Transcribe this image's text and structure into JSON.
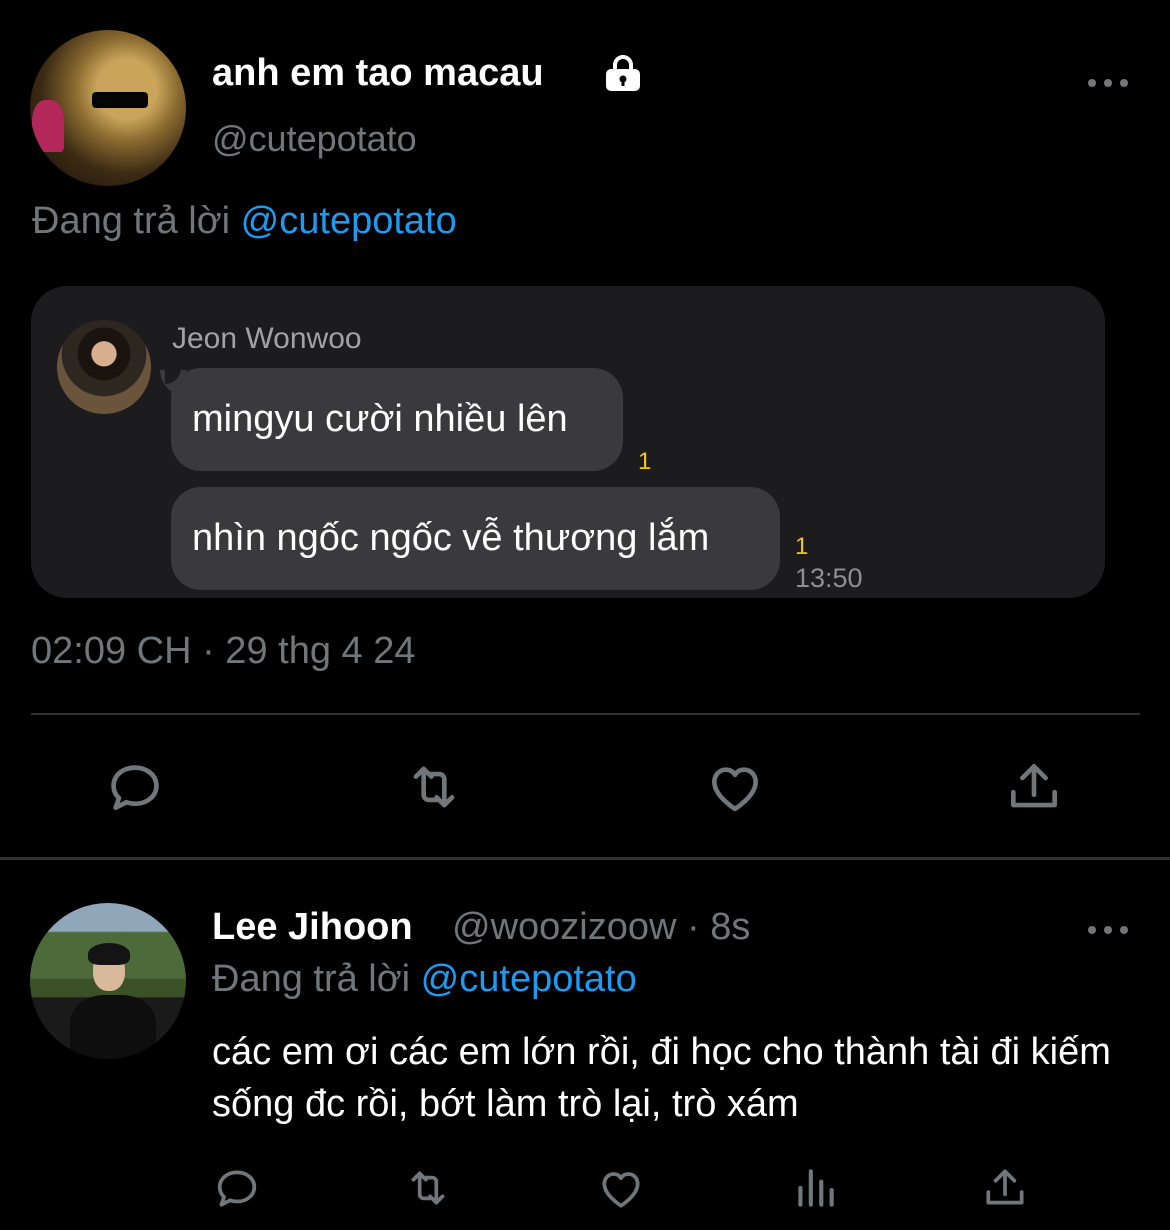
{
  "main_tweet": {
    "display_name": "anh em tao macau",
    "handle": "@cutepotato",
    "replying_prefix": "Đang trả lời",
    "replying_to": "@cutepotato",
    "timestamp": "02:09 CH · 29 thg 4 24",
    "embedded_chat": {
      "sender": "Jeon Wonwoo",
      "messages": [
        {
          "text": "mingyu cười nhiều lên",
          "read_count": "1"
        },
        {
          "text": "nhìn ngốc ngốc vễ thương lắm",
          "read_count": "1"
        }
      ],
      "time": "13:50"
    }
  },
  "reply_tweet": {
    "display_name": "Lee Jihoon",
    "handle_time": "@woozizoow · 8s",
    "replying_prefix": "Đang trả lời",
    "replying_to": "@cutepotato",
    "text": "các em ơi các em lớn rồi, đi học cho thành tài đi kiếm sống đc rồi, bớt làm trò lại, trò xám"
  },
  "icons": {
    "lock": "lock-icon",
    "more": "more-icon",
    "reply": "reply-icon",
    "retweet": "retweet-icon",
    "like": "heart-icon",
    "views": "views-icon",
    "share": "share-icon"
  },
  "colors": {
    "background": "#000000",
    "accent": "#1d9bf0",
    "muted": "#71767b",
    "read_receipt": "#f5c518"
  }
}
